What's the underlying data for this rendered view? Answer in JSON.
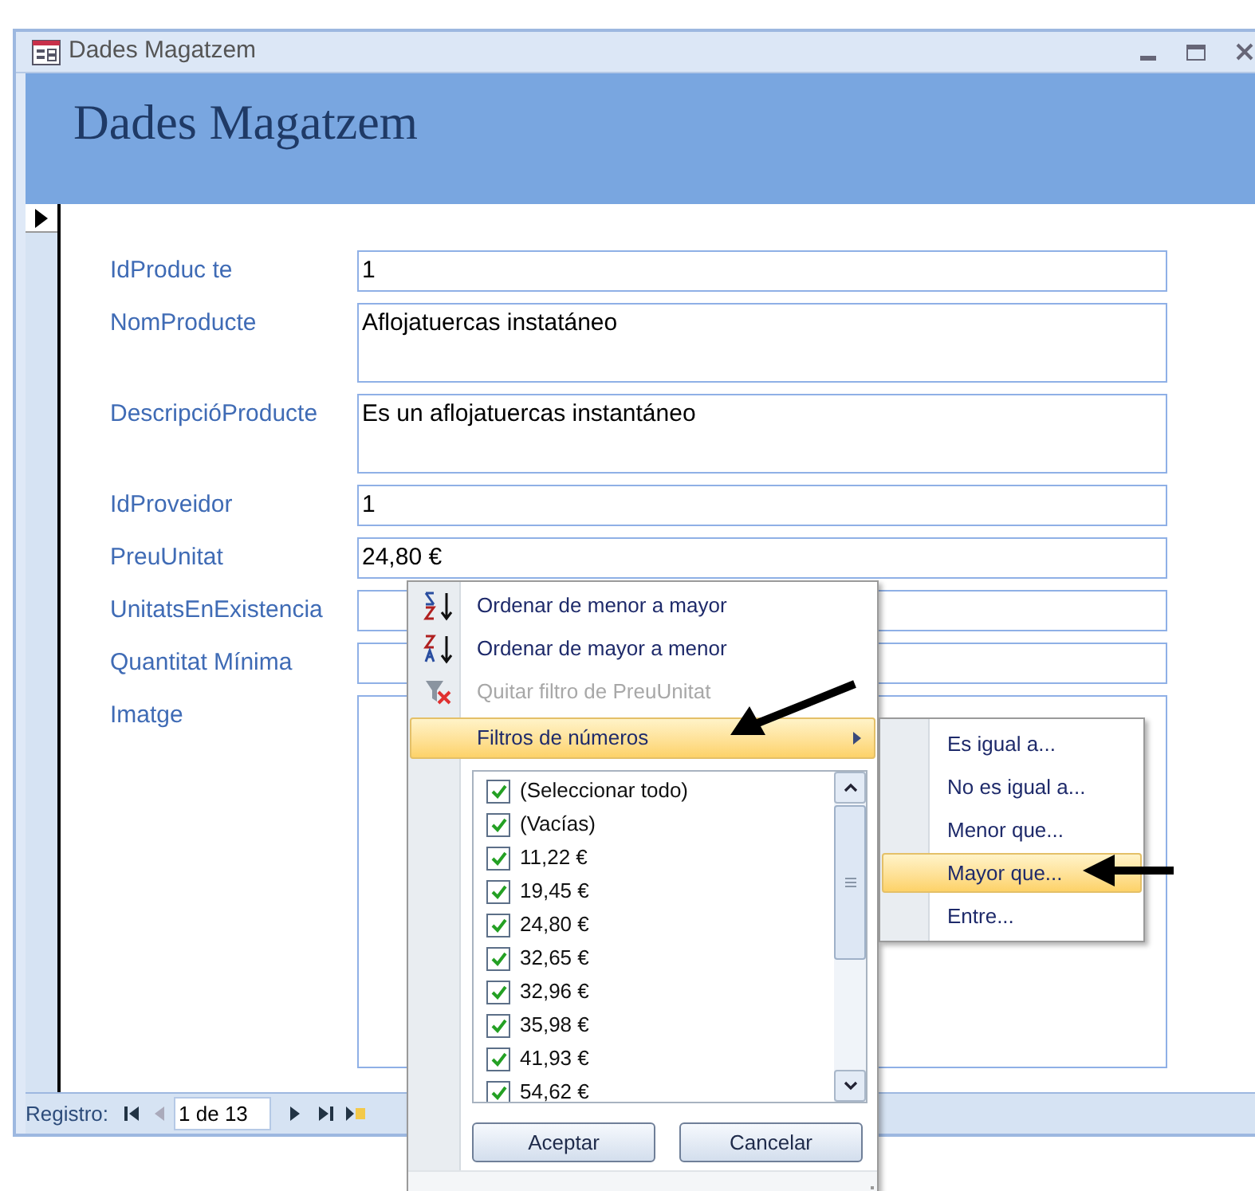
{
  "window": {
    "title": "Dades Magatzem"
  },
  "form": {
    "header": "Dades Magatzem",
    "fields": [
      {
        "label": "IdProduc te",
        "value": "1",
        "kind": "single"
      },
      {
        "label": "NomProducte",
        "value": "Aflojatuercas instatáneo",
        "kind": "double"
      },
      {
        "label": "DescripcióProducte",
        "value": "Es un aflojatuercas instantáneo",
        "kind": "double"
      },
      {
        "label": "IdProveidor",
        "value": "1",
        "kind": "single"
      },
      {
        "label": "PreuUnitat",
        "value": "24,80 €",
        "kind": "single"
      },
      {
        "label": "UnitatsEnExistencia",
        "kind": "single"
      },
      {
        "label": "Quantitat Mínima",
        "kind": "single"
      },
      {
        "label": "Imatge",
        "kind": "large"
      }
    ]
  },
  "navigation": {
    "label": "Registro:",
    "position": "1 de 13"
  },
  "filter_menu": {
    "items": [
      {
        "label": "Ordenar de menor a mayor",
        "kind": "sort-asc",
        "disabled": false,
        "selected": false
      },
      {
        "label": "Ordenar de mayor a menor",
        "kind": "sort-desc",
        "disabled": false,
        "selected": false
      },
      {
        "label": "Quitar filtro de PreuUnitat",
        "kind": "clear-filter",
        "disabled": true,
        "selected": false
      },
      {
        "label": "Filtros de números",
        "kind": "submenu",
        "disabled": false,
        "selected": true
      }
    ],
    "values": [
      {
        "label": "(Seleccionar todo)",
        "checked": true
      },
      {
        "label": "(Vacías)",
        "checked": true
      },
      {
        "label": "11,22 €",
        "checked": true
      },
      {
        "label": "19,45 €",
        "checked": true
      },
      {
        "label": "24,80 €",
        "checked": true
      },
      {
        "label": "32,65 €",
        "checked": true
      },
      {
        "label": "32,96 €",
        "checked": true
      },
      {
        "label": "35,98 €",
        "checked": true
      },
      {
        "label": "41,93 €",
        "checked": true
      },
      {
        "label": "54,62 €",
        "checked": true
      }
    ],
    "buttons": [
      "Aceptar",
      "Cancelar"
    ]
  },
  "number_filters": {
    "items": [
      {
        "label": "Es igual a...",
        "selected": false
      },
      {
        "label": "No es igual a...",
        "selected": false
      },
      {
        "label": "Menor que...",
        "selected": false
      },
      {
        "label": "Mayor que...",
        "selected": true
      },
      {
        "label": "Entre...",
        "selected": false
      }
    ]
  }
}
